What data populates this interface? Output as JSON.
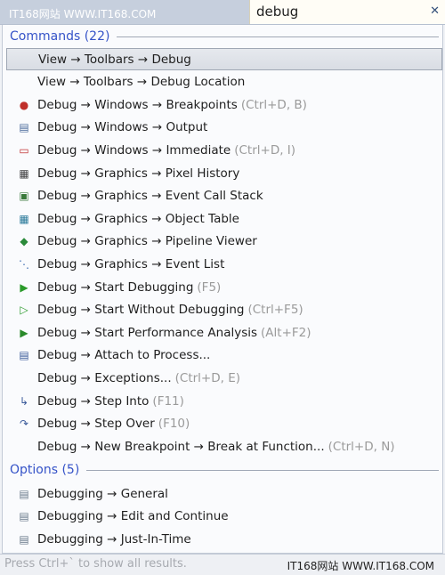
{
  "watermark": "IT168网站 WWW.IT168.COM",
  "search": {
    "value": "debug",
    "clear_icon": "close-icon"
  },
  "commands": {
    "header": "Commands (22)",
    "items": [
      {
        "text": "View → Toolbars → Debug",
        "shortcut": "",
        "icon": "none",
        "selected": true
      },
      {
        "text": "View → Toolbars → Debug Location",
        "shortcut": "",
        "icon": "none"
      },
      {
        "text": "Debug → Windows → Breakpoints",
        "shortcut": "(Ctrl+D, B)",
        "icon": "breakpoints-icon"
      },
      {
        "text": "Debug → Windows → Output",
        "shortcut": "",
        "icon": "output-icon"
      },
      {
        "text": "Debug → Windows → Immediate",
        "shortcut": "(Ctrl+D, I)",
        "icon": "immediate-icon"
      },
      {
        "text": "Debug → Graphics → Pixel History",
        "shortcut": "",
        "icon": "pixel-history-icon"
      },
      {
        "text": "Debug → Graphics → Event Call Stack",
        "shortcut": "",
        "icon": "call-stack-icon"
      },
      {
        "text": "Debug → Graphics → Object Table",
        "shortcut": "",
        "icon": "object-table-icon"
      },
      {
        "text": "Debug → Graphics → Pipeline Viewer",
        "shortcut": "",
        "icon": "pipeline-icon"
      },
      {
        "text": "Debug → Graphics → Event List",
        "shortcut": "",
        "icon": "event-list-icon"
      },
      {
        "text": "Debug → Start Debugging",
        "shortcut": "(F5)",
        "icon": "play-icon"
      },
      {
        "text": "Debug → Start Without Debugging",
        "shortcut": "(Ctrl+F5)",
        "icon": "play-outline-icon"
      },
      {
        "text": "Debug → Start Performance Analysis",
        "shortcut": "(Alt+F2)",
        "icon": "performance-icon"
      },
      {
        "text": "Debug → Attach to Process...",
        "shortcut": "",
        "icon": "attach-icon"
      },
      {
        "text": "Debug → Exceptions...",
        "shortcut": "(Ctrl+D, E)",
        "icon": "none"
      },
      {
        "text": "Debug → Step Into",
        "shortcut": "(F11)",
        "icon": "step-into-icon"
      },
      {
        "text": "Debug → Step Over",
        "shortcut": "(F10)",
        "icon": "step-over-icon"
      },
      {
        "text": "Debug → New Breakpoint → Break at Function...",
        "shortcut": "(Ctrl+D, N)",
        "icon": "none"
      }
    ]
  },
  "options": {
    "header": "Options (5)",
    "items": [
      {
        "text": "Debugging → General",
        "icon": "options-page-icon"
      },
      {
        "text": "Debugging → Edit and Continue",
        "icon": "options-page-icon"
      },
      {
        "text": "Debugging → Just-In-Time",
        "icon": "options-page-icon"
      }
    ]
  },
  "footer": {
    "hint": "Press Ctrl+` to show all results."
  }
}
